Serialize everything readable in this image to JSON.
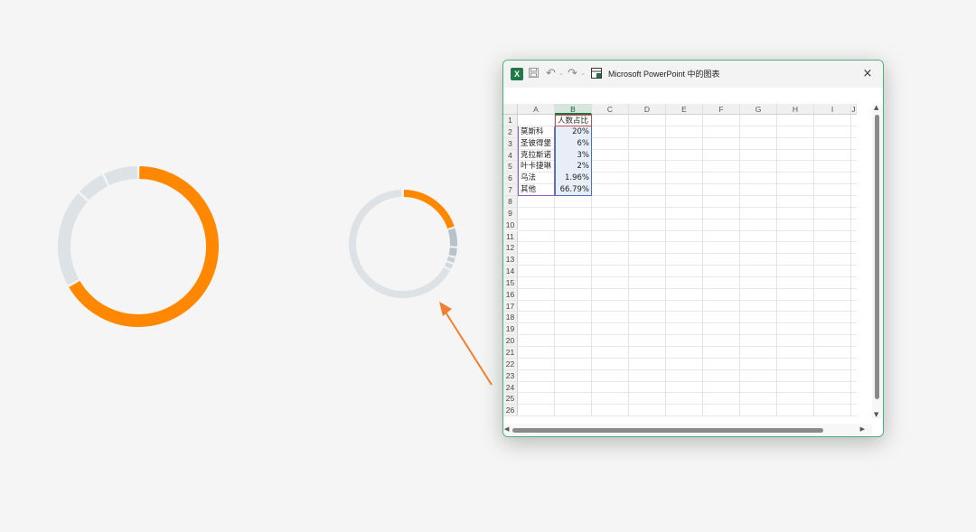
{
  "colors": {
    "accent": "#ff8800",
    "track": "#dde2e6",
    "segment_gray": "#b8c2ca",
    "excel_green": "#217346",
    "arrow": "#f08030"
  },
  "window": {
    "title": "Microsoft PowerPoint 中的图表",
    "close_label": "×",
    "icons": [
      "excel-icon",
      "save-icon",
      "undo-icon",
      "redo-icon",
      "sheet-icon",
      "close-icon"
    ]
  },
  "sheet": {
    "columns": [
      "A",
      "B",
      "C",
      "D",
      "E",
      "F",
      "G",
      "H",
      "I",
      "J"
    ],
    "rows": [
      "1",
      "2",
      "3",
      "4",
      "5",
      "6",
      "7",
      "8",
      "9",
      "10",
      "11",
      "12",
      "13",
      "14",
      "15",
      "16",
      "17",
      "18",
      "19",
      "20",
      "21",
      "22",
      "23",
      "24",
      "25",
      "26"
    ],
    "header_b1": "人数占比",
    "data": [
      {
        "label": "莫斯科",
        "value": "20%"
      },
      {
        "label": "圣彼得堡",
        "value": "6%"
      },
      {
        "label": "克拉斯诺",
        "value": "3%"
      },
      {
        "label": "叶卡捷琳",
        "value": "2%"
      },
      {
        "label": "乌法",
        "value": "1.96%"
      },
      {
        "label": "其他",
        "value": "66.79%"
      }
    ]
  },
  "donut_large": {
    "highlight": 0.6679,
    "segments": [
      0.6679,
      0.2,
      0.06,
      0.0721
    ]
  },
  "donut_small": {
    "segments": [
      0.2,
      0.06,
      0.03,
      0.02,
      0.0196,
      0.6679
    ]
  }
}
